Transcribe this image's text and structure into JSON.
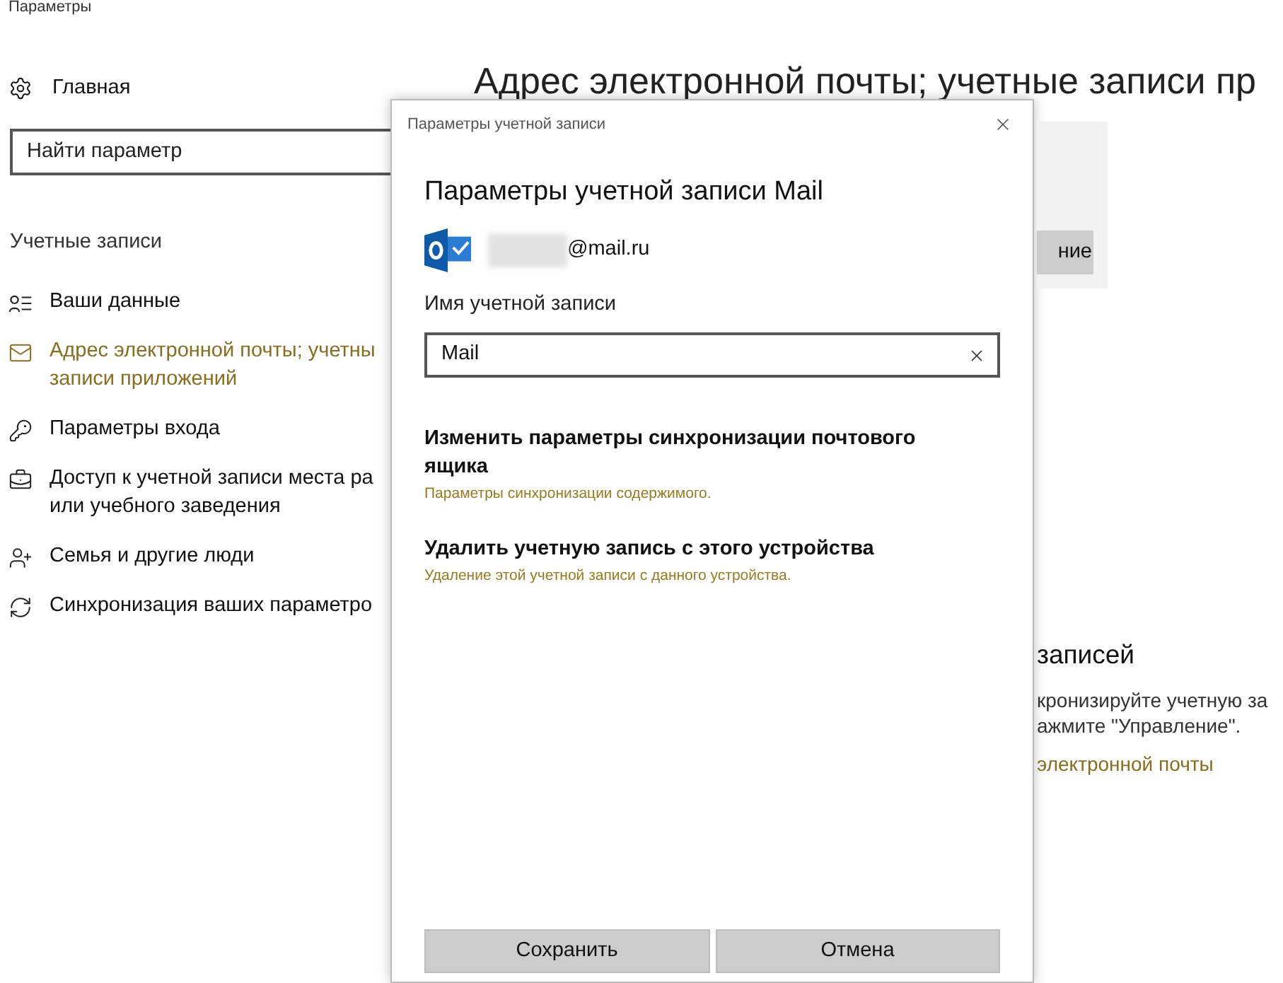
{
  "window": {
    "title": "Параметры"
  },
  "sidebar": {
    "home": "Главная",
    "search": {
      "placeholder": "Найти параметр"
    },
    "section": "Учетные записи",
    "items": [
      {
        "label": "Ваши данные",
        "selected": false
      },
      {
        "label": "Адрес электронной почты; учетны\nзаписи приложений",
        "selected": true
      },
      {
        "label": "Параметры входа",
        "selected": false
      },
      {
        "label": "Доступ к учетной записи места ра\nили учебного заведения",
        "selected": false
      },
      {
        "label": "Семья и другие люди",
        "selected": false
      },
      {
        "label": "Синхронизация ваших параметро",
        "selected": false
      }
    ]
  },
  "page": {
    "heading": "Адрес электронной почты; учетные записи пр",
    "button": "ние",
    "section_title": "записей",
    "lines": [
      "кронизируйте учетную за",
      "ажмите \"Управление\"."
    ],
    "link": "электронной почты"
  },
  "dialog": {
    "title": "Параметры учетной записи",
    "heading": "Параметры учетной записи Mail",
    "email": "@mail.ru",
    "field_label": "Имя учетной записи",
    "field_value": "Mail",
    "actions": [
      {
        "title": "Изменить параметры синхронизации почтового ящика",
        "subtitle": "Параметры синхронизации содержимого."
      },
      {
        "title": "Удалить учетную запись с этого устройства",
        "subtitle": "Удаление этой учетной записи с данного устройства."
      }
    ],
    "buttons": [
      "Сохранить",
      "Отмена"
    ]
  }
}
